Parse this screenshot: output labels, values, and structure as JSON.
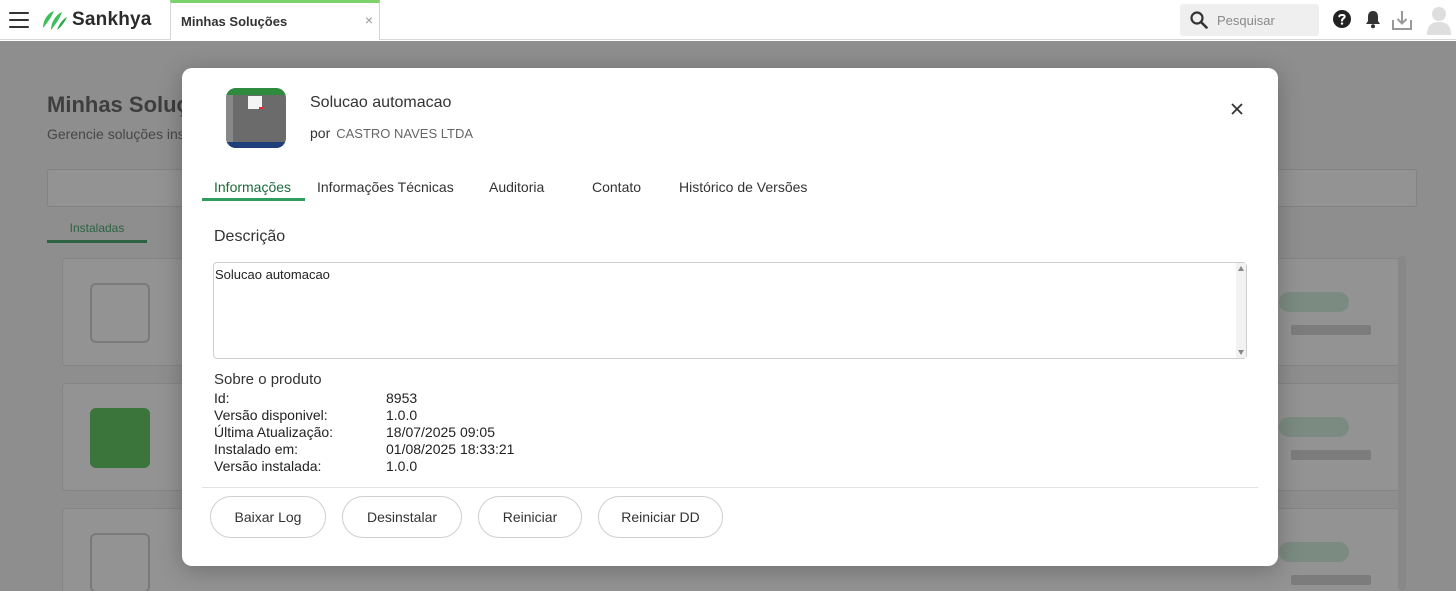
{
  "topbar": {
    "logo_text": "Sankhya",
    "active_tab": "Minhas Soluções",
    "tab_close": "×",
    "search_placeholder": "Pesquisar"
  },
  "background": {
    "page_title": "Minhas Soluções",
    "page_subtitle": "Gerencie soluções instaladas",
    "tab_label": "Instaladas"
  },
  "modal": {
    "app_name": "Solucao automacao",
    "by_label": "por",
    "vendor": "CASTRO NAVES LTDA",
    "tabs": [
      {
        "label": "Informações"
      },
      {
        "label": "Informações Técnicas"
      },
      {
        "label": "Auditoria"
      },
      {
        "label": "Contato"
      },
      {
        "label": "Histórico de Versões"
      }
    ],
    "description_title": "Descrição",
    "description_text": "Solucao automacao",
    "about_title": "Sobre o produto",
    "info": [
      {
        "key": "Id:",
        "value": "8953"
      },
      {
        "key": "Versão disponivel:",
        "value": "1.0.0"
      },
      {
        "key": "Última Atualização:",
        "value": "18/07/2025 09:05"
      },
      {
        "key": "Instalado em:",
        "value": "01/08/2025 18:33:21"
      },
      {
        "key": "Versão instalada:",
        "value": "1.0.0"
      }
    ],
    "buttons": {
      "download_log": "Baixar Log",
      "uninstall": "Desinstalar",
      "restart": "Reiniciar",
      "restart_dd": "Reiniciar DD"
    }
  },
  "colors": {
    "accent_green": "#2e9e5e",
    "tab_top_border": "#7cd36b"
  }
}
